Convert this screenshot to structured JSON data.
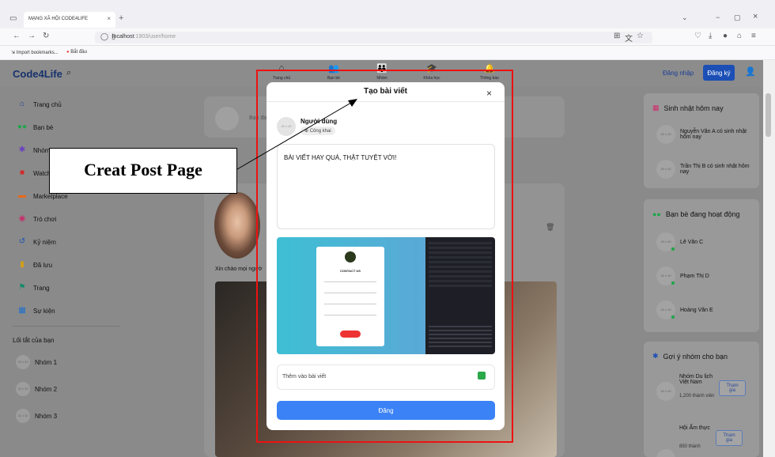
{
  "browser": {
    "tab_title": "MẠNG XÃ HỘI CODE4LIFE",
    "tab_close": "×",
    "new_tab": "+",
    "url_host": "localhost",
    "url_path": ":1903/user/home",
    "bookmarks": [
      {
        "label": "Import bookmarks..."
      },
      {
        "label": "Bắt đầu"
      }
    ],
    "win_min": "−",
    "win_max": "▢",
    "win_close": "×"
  },
  "app": {
    "brand": "Code4Life",
    "nav": [
      {
        "label": "Trang chủ"
      },
      {
        "label": "Bạn bè"
      },
      {
        "label": "Nhóm"
      },
      {
        "label": "Khóa học"
      },
      {
        "label": "Thông báo"
      }
    ],
    "login": "Đăng nhập",
    "register": "Đăng ký"
  },
  "sidebar": {
    "items": [
      {
        "label": "Trang chủ",
        "icon": "home-icon",
        "color": "#1b3d96"
      },
      {
        "label": "Bạn bè",
        "icon": "friends-icon",
        "color": "#1ea64a"
      },
      {
        "label": "Nhóm",
        "icon": "group-icon",
        "color": "#6a3fc1"
      },
      {
        "label": "Watch",
        "icon": "video-icon",
        "color": "#d12a2a"
      },
      {
        "label": "Marketplace",
        "icon": "store-icon",
        "color": "#e66a1a"
      },
      {
        "label": "Trò chơi",
        "icon": "game-icon",
        "color": "#c92a6a"
      },
      {
        "label": "Kỷ niệm",
        "icon": "history-icon",
        "color": "#1b4fb6"
      },
      {
        "label": "Đã lưu",
        "icon": "bookmark-icon",
        "color": "#d4a017"
      },
      {
        "label": "Trang",
        "icon": "flag-icon",
        "color": "#138a6a"
      },
      {
        "label": "Sự kiện",
        "icon": "calendar-icon",
        "color": "#1b6fd1"
      }
    ],
    "shortcut_title": "Lối tắt của bạn",
    "groups": [
      {
        "label": "Nhóm 1"
      },
      {
        "label": "Nhóm 2"
      },
      {
        "label": "Nhóm 3"
      }
    ],
    "avatar_ph": "32 x 32"
  },
  "feed": {
    "composer_placeholder": "Bạn đa",
    "greeting": "Xin chào mọi ngườ"
  },
  "right": {
    "birthday_title": "Sinh nhật hôm nay",
    "birthdays": [
      {
        "text": "Nguyễn Văn A có sinh nhật hôm nay"
      },
      {
        "text": "Trần Thị B có sinh nhật hôm nay"
      }
    ],
    "active_title": "Bạn bè đang hoạt động",
    "active": [
      {
        "name": "Lê Văn C"
      },
      {
        "name": "Phạm Thị D"
      },
      {
        "name": "Hoàng Văn E"
      }
    ],
    "groups_title": "Gợi ý nhóm cho bạn",
    "group_suggestions": [
      {
        "name": "Nhóm Du lịch Việt Nam",
        "members": "1,200 thành viên",
        "join": "Tham gia"
      },
      {
        "name": "Hội Ẩm thực",
        "members": "850 thành",
        "join": "Tham gia"
      }
    ],
    "avatar_ph": "40 x 40"
  },
  "modal": {
    "title": "Tạo bài viết",
    "close": "×",
    "user_name": "Người dùng",
    "privacy": "Công khai",
    "avatar_ph": "40 x 40",
    "post_text": "BÀI VIẾT HAY QUÁ, THẬT TUYỆT VỜI!",
    "image_caption": "CONTACT US",
    "add_to_post": "Thêm vào bài viết",
    "post_button": "Đăng"
  },
  "annotation": {
    "callout": "Creat Post Page"
  }
}
